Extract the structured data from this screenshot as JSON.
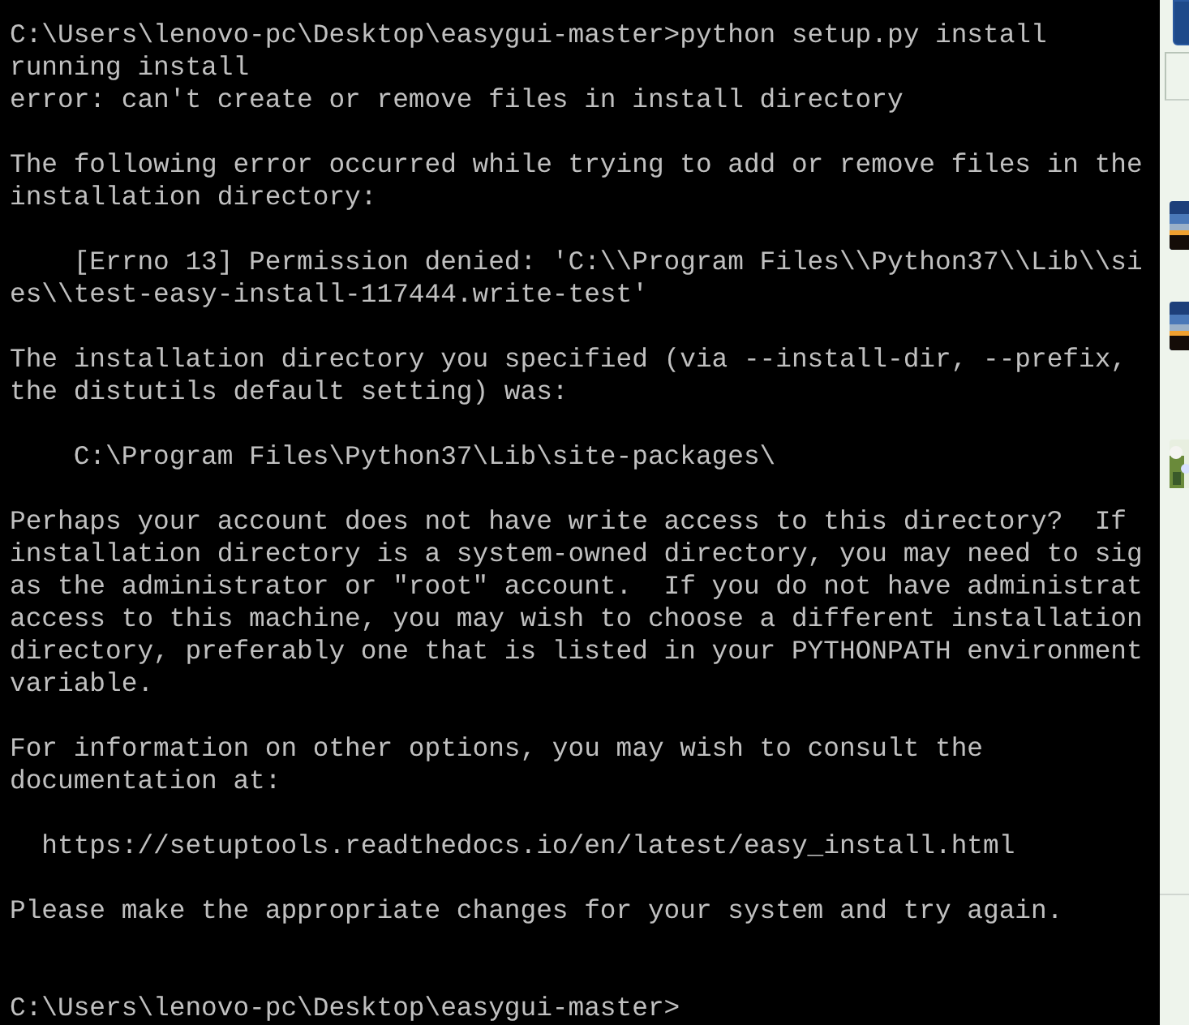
{
  "terminal": {
    "paragraphs": [
      [
        "C:\\Users\\lenovo-pc\\Desktop\\easygui-master>python setup.py install",
        "running install",
        "error: can't create or remove files in install directory"
      ],
      [
        "The following error occurred while trying to add or remove files in the",
        "installation directory:"
      ],
      [
        "    [Errno 13] Permission denied: 'C:\\\\Program Files\\\\Python37\\\\Lib\\\\si",
        "es\\\\test-easy-install-117444.write-test'"
      ],
      [
        "The installation directory you specified (via --install-dir, --prefix,",
        "the distutils default setting) was:"
      ],
      [
        "    C:\\Program Files\\Python37\\Lib\\site-packages\\"
      ],
      [
        "Perhaps your account does not have write access to this directory?  If",
        "installation directory is a system-owned directory, you may need to sig",
        "as the administrator or \"root\" account.  If you do not have administrat",
        "access to this machine, you may wish to choose a different installation",
        "directory, preferably one that is listed in your PYTHONPATH environment",
        "variable."
      ],
      [
        "For information on other options, you may wish to consult the",
        "documentation at:"
      ],
      [
        "  https://setuptools.readthedocs.io/en/latest/easy_install.html"
      ],
      [
        "Please make the appropriate changes for your system and try again."
      ]
    ],
    "prompt": "C:\\Users\\lenovo-pc\\Desktop\\easygui-master>"
  }
}
